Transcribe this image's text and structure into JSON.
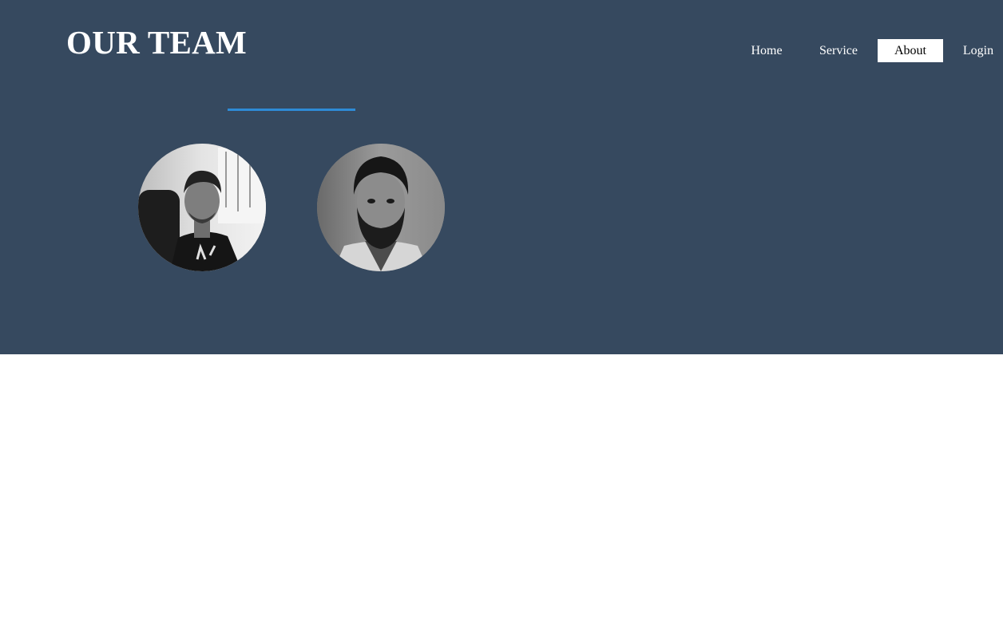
{
  "header": {
    "title": "OUR TEAM"
  },
  "nav": {
    "items": [
      {
        "label": "Home",
        "active": false
      },
      {
        "label": "Service",
        "active": false
      },
      {
        "label": "About",
        "active": true
      },
      {
        "label": "Login",
        "active": false
      }
    ]
  },
  "colors": {
    "hero_background": "#36495f",
    "accent_underline": "#2e8bd6",
    "text": "#ffffff",
    "active_nav_background": "#ffffff",
    "active_nav_text": "#000000"
  },
  "team": {
    "members": [
      {
        "photo": "member-photo-1",
        "style": "grayscale portrait"
      },
      {
        "photo": "member-photo-2",
        "style": "grayscale portrait"
      }
    ]
  }
}
